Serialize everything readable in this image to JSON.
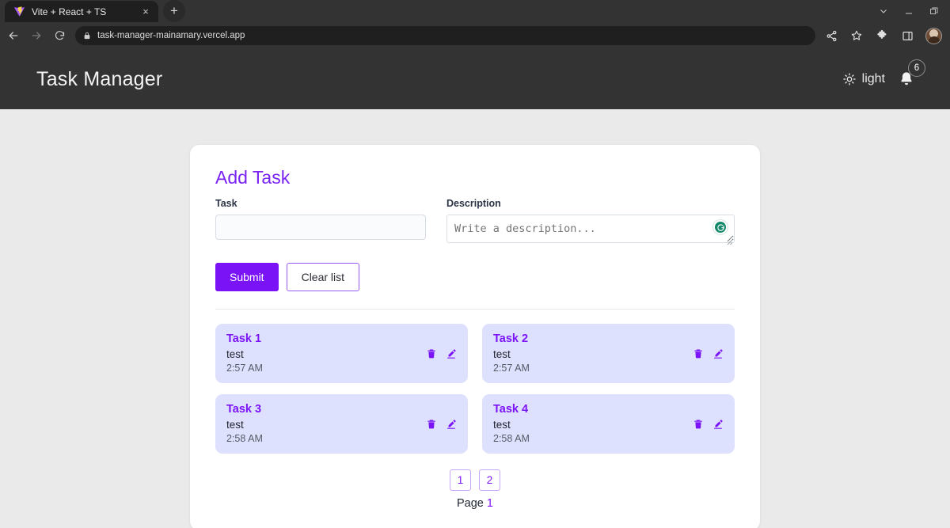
{
  "browser": {
    "tab": {
      "title": "Vite + React + TS",
      "favicon": "vite-logo-icon",
      "close": "×"
    },
    "new_tab_label": "+",
    "window_controls": [
      "chevron-down-icon",
      "minimize-icon",
      "restore-icon"
    ],
    "nav": {
      "back": "←",
      "forward": "→",
      "reload": "⟳"
    },
    "omnibox": {
      "url": "task-manager-mainamary.vercel.app",
      "lock": "lock-icon"
    },
    "toolbar_icons": [
      "share-icon",
      "star-icon",
      "extensions-icon",
      "side-panel-icon",
      "profile-avatar"
    ]
  },
  "app": {
    "title": "Task Manager",
    "theme_toggle": {
      "label": "light",
      "icon": "sun-icon"
    },
    "notifications": {
      "icon": "bell-icon",
      "count": "6"
    }
  },
  "form": {
    "section_title": "Add Task",
    "task": {
      "label": "Task",
      "value": "",
      "placeholder": ""
    },
    "description": {
      "label": "Description",
      "value": "",
      "placeholder": "Write a description...",
      "assistant_icon": "grammarly-icon"
    },
    "submit_label": "Submit",
    "clear_label": "Clear list"
  },
  "tasks": [
    {
      "title": "Task 1",
      "description": "test",
      "time": "2:57 AM",
      "delete_icon": "trash-icon",
      "edit_icon": "pencil-icon"
    },
    {
      "title": "Task 2",
      "description": "test",
      "time": "2:57 AM",
      "delete_icon": "trash-icon",
      "edit_icon": "pencil-icon"
    },
    {
      "title": "Task 3",
      "description": "test",
      "time": "2:58 AM",
      "delete_icon": "trash-icon",
      "edit_icon": "pencil-icon"
    },
    {
      "title": "Task 4",
      "description": "test",
      "time": "2:58 AM",
      "delete_icon": "trash-icon",
      "edit_icon": "pencil-icon"
    }
  ],
  "pagination": {
    "pages": [
      "1",
      "2"
    ],
    "status_prefix": "Page",
    "current": "1"
  },
  "colors": {
    "accent": "#7b13f7",
    "accent_heading": "#7a22f0",
    "task_card_bg": "#dee1fd",
    "page_bg": "#eaeaea",
    "header_bg": "#333333",
    "grammarly_green": "#15876a"
  }
}
